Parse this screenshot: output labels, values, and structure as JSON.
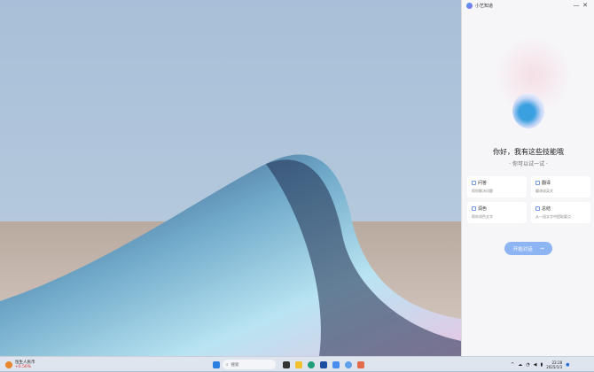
{
  "app": {
    "title": "小艺知道",
    "minimize": "—",
    "close": "✕"
  },
  "main": {
    "greeting": "你好，我有这些技能哦",
    "hint": "· 你可以试一试 ·",
    "cards": [
      {
        "title": "问答",
        "desc": "帮你解决问题"
      },
      {
        "title": "翻译",
        "desc": "翻译成英文"
      },
      {
        "title": "润色",
        "desc": "帮你润色文字"
      },
      {
        "title": "总结",
        "desc": "从一段文字中提取要点"
      }
    ],
    "start_label": "开始对话",
    "start_arrow": "→"
  },
  "taskbar": {
    "widget_title": "恒生人民币",
    "widget_value": "+0.56%",
    "search_placeholder": "搜索",
    "time": "22:28",
    "date": "2025/1/3",
    "notify_badge": "1"
  }
}
